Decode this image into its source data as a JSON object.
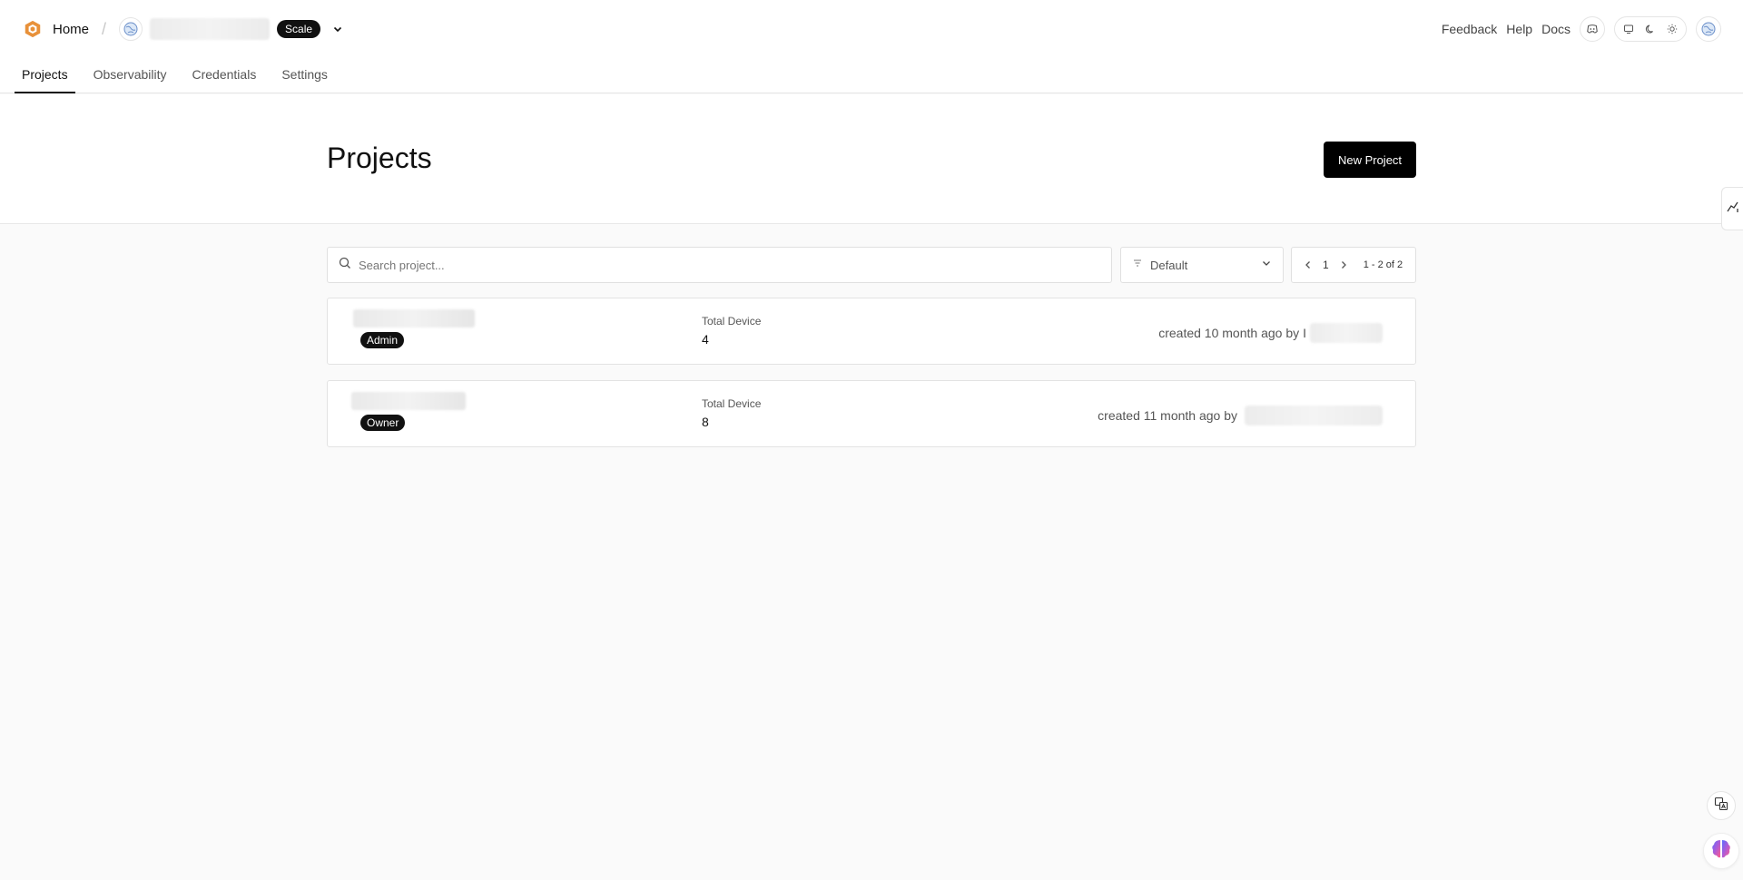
{
  "header": {
    "home_label": "Home",
    "plan_badge": "Scale",
    "links": [
      "Feedback",
      "Help",
      "Docs"
    ]
  },
  "tabs": [
    {
      "label": "Projects",
      "active": true
    },
    {
      "label": "Observability",
      "active": false
    },
    {
      "label": "Credentials",
      "active": false
    },
    {
      "label": "Settings",
      "active": false
    }
  ],
  "page": {
    "title": "Projects",
    "new_project_label": "New Project"
  },
  "filters": {
    "search_placeholder": "Search project...",
    "sort_value": "Default",
    "page_number": "1",
    "page_range": "1 - 2 of 2"
  },
  "projects": [
    {
      "role": "Admin",
      "devices_label": "Total Device",
      "devices": "4",
      "created": "created 10 month ago by",
      "creator_initial": "I"
    },
    {
      "role": "Owner",
      "devices_label": "Total Device",
      "devices": "8",
      "created": "created 11 month ago by",
      "creator_initial": ""
    }
  ],
  "colors": {
    "brand_logo": "#e8913a",
    "accent": "#000000",
    "background": "#fafafa"
  }
}
